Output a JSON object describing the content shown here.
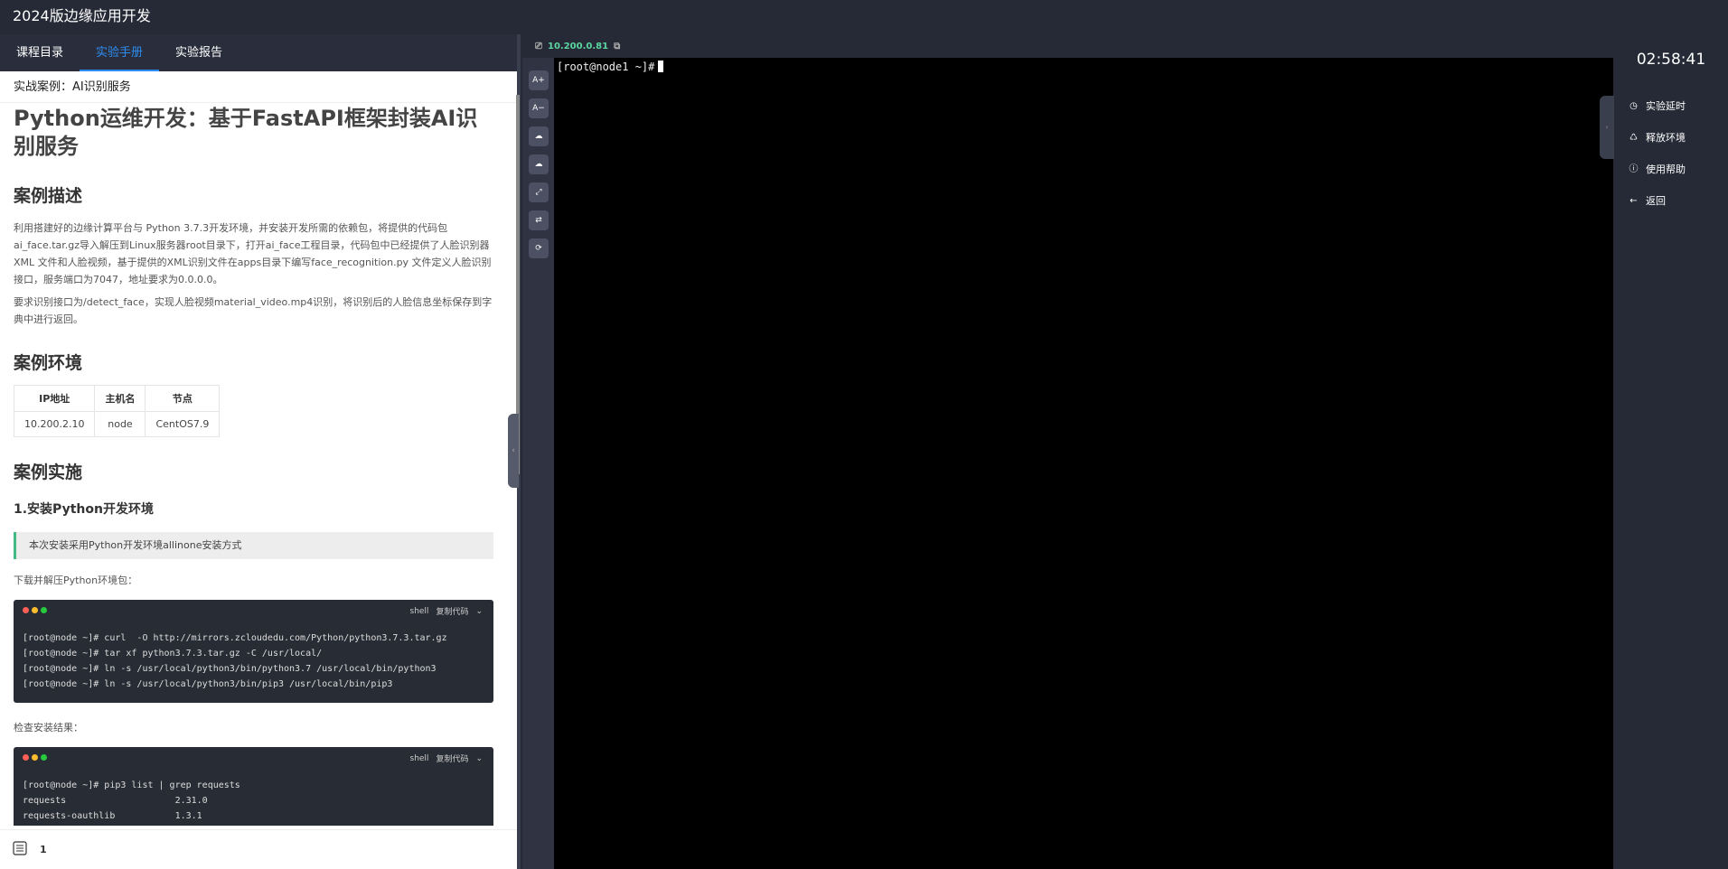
{
  "app": {
    "title": "2024版边缘应用开发"
  },
  "tabs": [
    {
      "label": "课程目录",
      "active": false
    },
    {
      "label": "实验手册",
      "active": true
    },
    {
      "label": "实验报告",
      "active": false
    }
  ],
  "breadcrumb": "实战案例：AI识别服务",
  "doc": {
    "title": "Python运维开发：基于FastAPI框架封装AI识别服务",
    "section1": "案例描述",
    "desc1": "利用搭建好的边缘计算平台与 Python 3.7.3开发环境，并安装开发所需的依赖包，将提供的代码包ai_face.tar.gz导入解压到Linux服务器root目录下，打开ai_face工程目录，代码包中已经提供了人脸识别器 XML 文件和人脸视频，基于提供的XML识别文件在apps目录下编写face_recognition.py 文件定义人脸识别接口，服务端口为7047，地址要求为0.0.0.0。",
    "desc2": "要求识别接口为/detect_face，实现人脸视频material_video.mp4识别，将识别后的人脸信息坐标保存到字典中进行返回。",
    "section2": "案例环境",
    "table": {
      "headers": [
        "IP地址",
        "主机名",
        "节点"
      ],
      "rows": [
        [
          "10.200.2.10",
          "node",
          "CentOS7.9"
        ]
      ]
    },
    "section3": "案例实施",
    "subsection1": "1.安装Python开发环境",
    "quote": "本次安装采用Python开发环境allinone安装方式",
    "para_download": "下载并解压Python环境包：",
    "code1": {
      "lang": "shell",
      "copy": "复制代码",
      "lines": [
        "[root@node ~]# curl  -O http://mirrors.zcloudedu.com/Python/python3.7.3.tar.gz",
        "[root@node ~]# tar xf python3.7.3.tar.gz -C /usr/local/",
        "[root@node ~]# ln -s /usr/local/python3/bin/python3.7 /usr/local/bin/python3",
        "[root@node ~]# ln -s /usr/local/python3/bin/pip3 /usr/local/bin/pip3"
      ]
    },
    "para_check": "检查安装结果：",
    "code2": {
      "lang": "shell",
      "copy": "复制代码",
      "lines": [
        "[root@node ~]# pip3 list | grep requests",
        "requests                    2.31.0",
        "requests-oauthlib           1.3.1"
      ]
    }
  },
  "footer": {
    "page": "1"
  },
  "terminal": {
    "ip": "10.200.0.81",
    "prompt": "[root@node1 ~]#",
    "toolbar": [
      "A+",
      "A−",
      "☁",
      "☁",
      "⤢",
      "⇄",
      "⟳"
    ]
  },
  "sidebar": {
    "timer": "02:58:41",
    "items": [
      {
        "label": "实验延时",
        "icon": "clock-icon"
      },
      {
        "label": "释放环境",
        "icon": "recycle-icon"
      },
      {
        "label": "使用帮助",
        "icon": "help-icon"
      },
      {
        "label": "返回",
        "icon": "arrow-left-icon"
      }
    ]
  },
  "colors": {
    "accent": "#2d8cf0",
    "terminal_ip": "#5bd6a0",
    "quote_border": "#42b983"
  }
}
